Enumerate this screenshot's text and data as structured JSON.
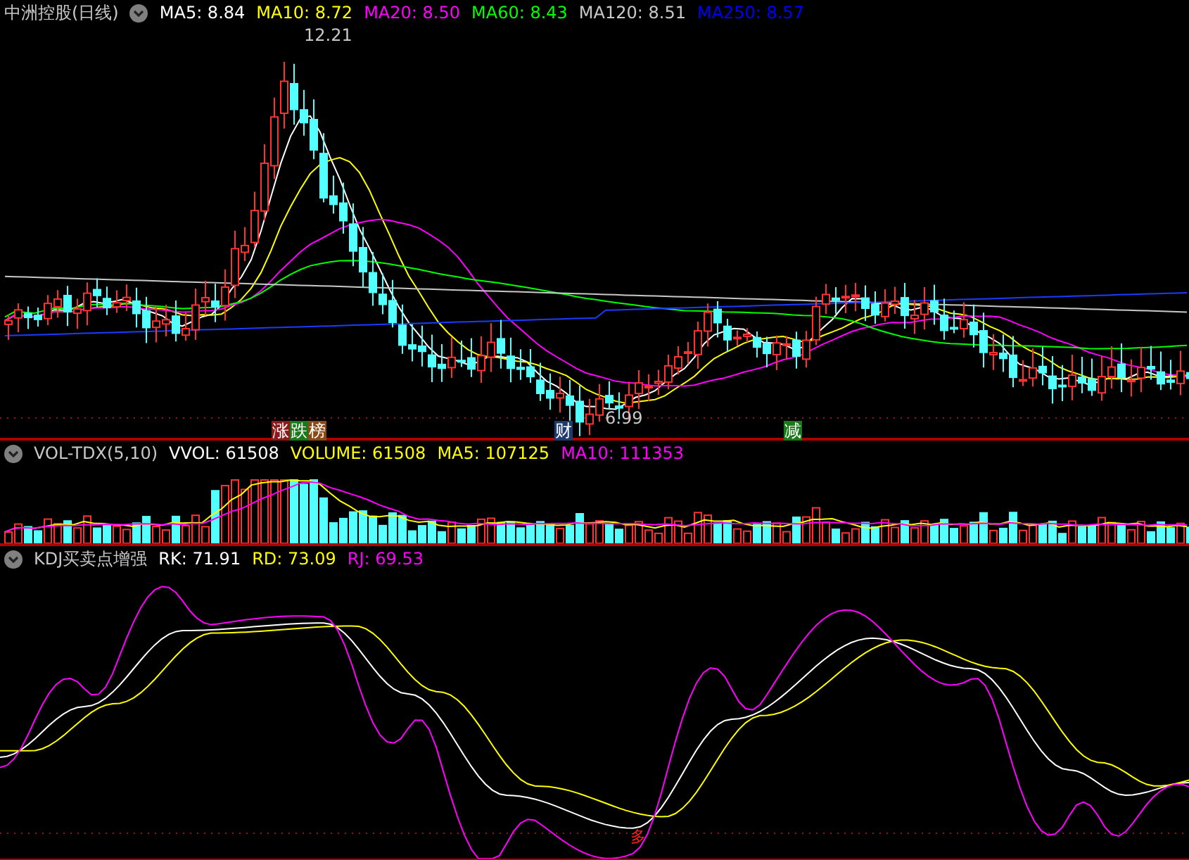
{
  "chart_title": "中洲控股(日线)",
  "price_indicators": [
    {
      "label": "MA5: 8.84",
      "color": "#ffffff"
    },
    {
      "label": "MA10: 8.72",
      "color": "#ffff00"
    },
    {
      "label": "MA20: 8.50",
      "color": "#ff00ff"
    },
    {
      "label": "MA60: 8.43",
      "color": "#00ff00"
    },
    {
      "label": "MA120: 8.51",
      "color": "#c8c8c8"
    },
    {
      "label": "MA250: 8.57",
      "color": "#0000ff"
    }
  ],
  "price_labels": {
    "high": "12.21",
    "low": "6.99"
  },
  "event_markers": [
    {
      "text": "涨",
      "color": "#8b1a1a"
    },
    {
      "text": "跌",
      "color": "#1a7a1a"
    },
    {
      "text": "榜",
      "color": "#8b4a13"
    },
    {
      "text": "财",
      "color": "#1e3a6e"
    },
    {
      "text": "减",
      "color": "#1a7a1a"
    }
  ],
  "volume_panel": {
    "name": "VOL-TDX(5,10)",
    "indicators": [
      {
        "label": "VVOL: 61508",
        "color": "#ffffff"
      },
      {
        "label": "VOLUME: 61508",
        "color": "#ffff00"
      },
      {
        "label": "MA5: 107125",
        "color": "#ffff00"
      },
      {
        "label": "MA10: 111353",
        "color": "#ff00ff"
      }
    ]
  },
  "kdj_panel": {
    "name": "KDJ买卖点增强",
    "indicators": [
      {
        "label": "RK: 71.91",
        "color": "#ffffff"
      },
      {
        "label": "RD: 73.09",
        "color": "#ffff00"
      },
      {
        "label": "RJ: 69.53",
        "color": "#ff00ff"
      }
    ],
    "signal": "多"
  }
}
